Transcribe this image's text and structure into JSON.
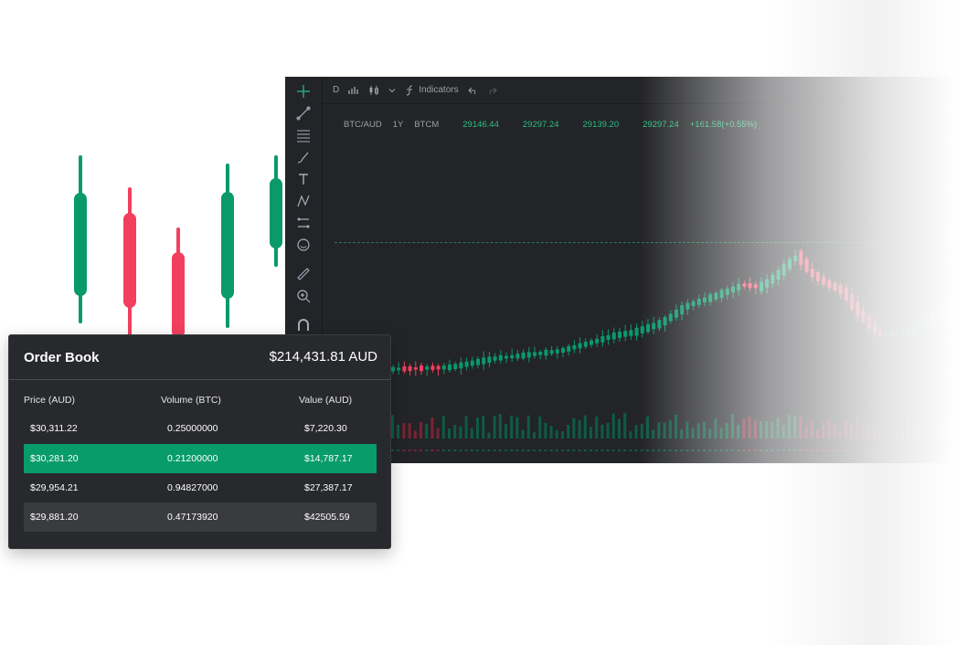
{
  "colors": {
    "up": "#0a9a6a",
    "down": "#f23f5e",
    "panel": "#28292c",
    "chart_bg": "#232427",
    "highlight": "#089c6a",
    "row_alt": "#3a3b3f"
  },
  "chart": {
    "toolbar_icons": [
      "crosshair-icon",
      "trend-line-icon",
      "fib-lines-icon",
      "brush-icon",
      "text-icon",
      "pattern-icon",
      "measure-lines-icon",
      "emoji-icon",
      "ruler-icon",
      "zoom-in-icon",
      "magnet-icon"
    ],
    "topbar": {
      "interval": "D",
      "indicators_label": "Indicators",
      "icons": [
        "bar-chart-icon",
        "candles-icon",
        "chevron-down-icon",
        "function-icon",
        "undo-icon",
        "redo-icon"
      ]
    },
    "ohlc": {
      "symbol": "BTC/AUD",
      "period": "1Y",
      "exchange": "BTCM",
      "open": "29146.44",
      "high": "29297.24",
      "low": "29139.20",
      "close": "29297.24",
      "change": "+161.58(+0.55%)"
    }
  },
  "order_book": {
    "title": "Order Book",
    "total": "$214,431.81 AUD",
    "columns": [
      "Price (AUD)",
      "Volume (BTC)",
      "Value (AUD)"
    ],
    "rows": [
      {
        "price": "$30,311.22",
        "volume": "0.25000000",
        "value": "$7,220.30",
        "state": "normal"
      },
      {
        "price": "$30,281.20",
        "volume": "0.21200000",
        "value": "$14,787.17",
        "state": "highlighted"
      },
      {
        "price": "$29,954.21",
        "volume": "0.94827000",
        "value": "$27,387.17",
        "state": "normal"
      },
      {
        "price": "$29,881.20",
        "volume": "0.47173920",
        "value": "$42505.59",
        "state": "alternate"
      }
    ]
  }
}
